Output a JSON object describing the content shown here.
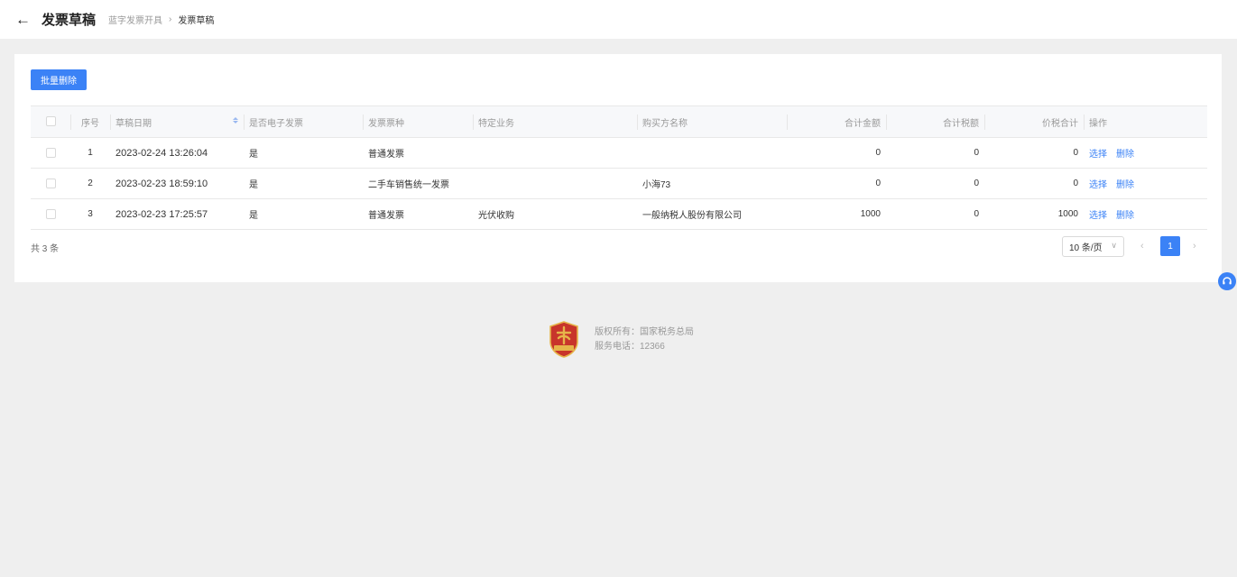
{
  "header": {
    "back_icon": "arrow-left-icon",
    "title": "发票草稿",
    "breadcrumb": {
      "parent": "蓝字发票开具",
      "separator": "›",
      "current": "发票草稿"
    }
  },
  "toolbar": {
    "batch_delete_label": "批量删除"
  },
  "table": {
    "columns": [
      "序号",
      "草稿日期",
      "是否电子发票",
      "发票票种",
      "特定业务",
      "购买方名称",
      "合计金额",
      "合计税额",
      "价税合计",
      "操作"
    ],
    "rows": [
      {
        "index": "1",
        "date": "2023-02-24 13:26:04",
        "electronic": "是",
        "invoice_type": "普通发票",
        "business": "",
        "buyer": "",
        "amount": "0",
        "tax": "0",
        "total": "0",
        "action_select": "选择",
        "action_delete": "删除"
      },
      {
        "index": "2",
        "date": "2023-02-23 18:59:10",
        "electronic": "是",
        "invoice_type": "二手车销售统一发票",
        "business": "",
        "buyer": "小海73",
        "amount": "0",
        "tax": "0",
        "total": "0",
        "action_select": "选择",
        "action_delete": "删除"
      },
      {
        "index": "3",
        "date": "2023-02-23 17:25:57",
        "electronic": "是",
        "invoice_type": "普通发票",
        "business": "光伏收购",
        "buyer": "一般纳税人股份有限公司",
        "amount": "1000",
        "tax": "0",
        "total": "1000",
        "action_select": "选择",
        "action_delete": "删除"
      }
    ]
  },
  "pagination": {
    "total_text": "共 3 条",
    "page_size": "10 条/页",
    "current_page": "1",
    "prev": "‹",
    "next": "›"
  },
  "footer": {
    "copyright": "版权所有：国家税务总局",
    "phone": "服务电话：12366",
    "logo_text": "中国税务"
  },
  "colors": {
    "accent": "#3b82f6",
    "logo_red": "#c8352b",
    "logo_gold": "#e6b54a"
  }
}
